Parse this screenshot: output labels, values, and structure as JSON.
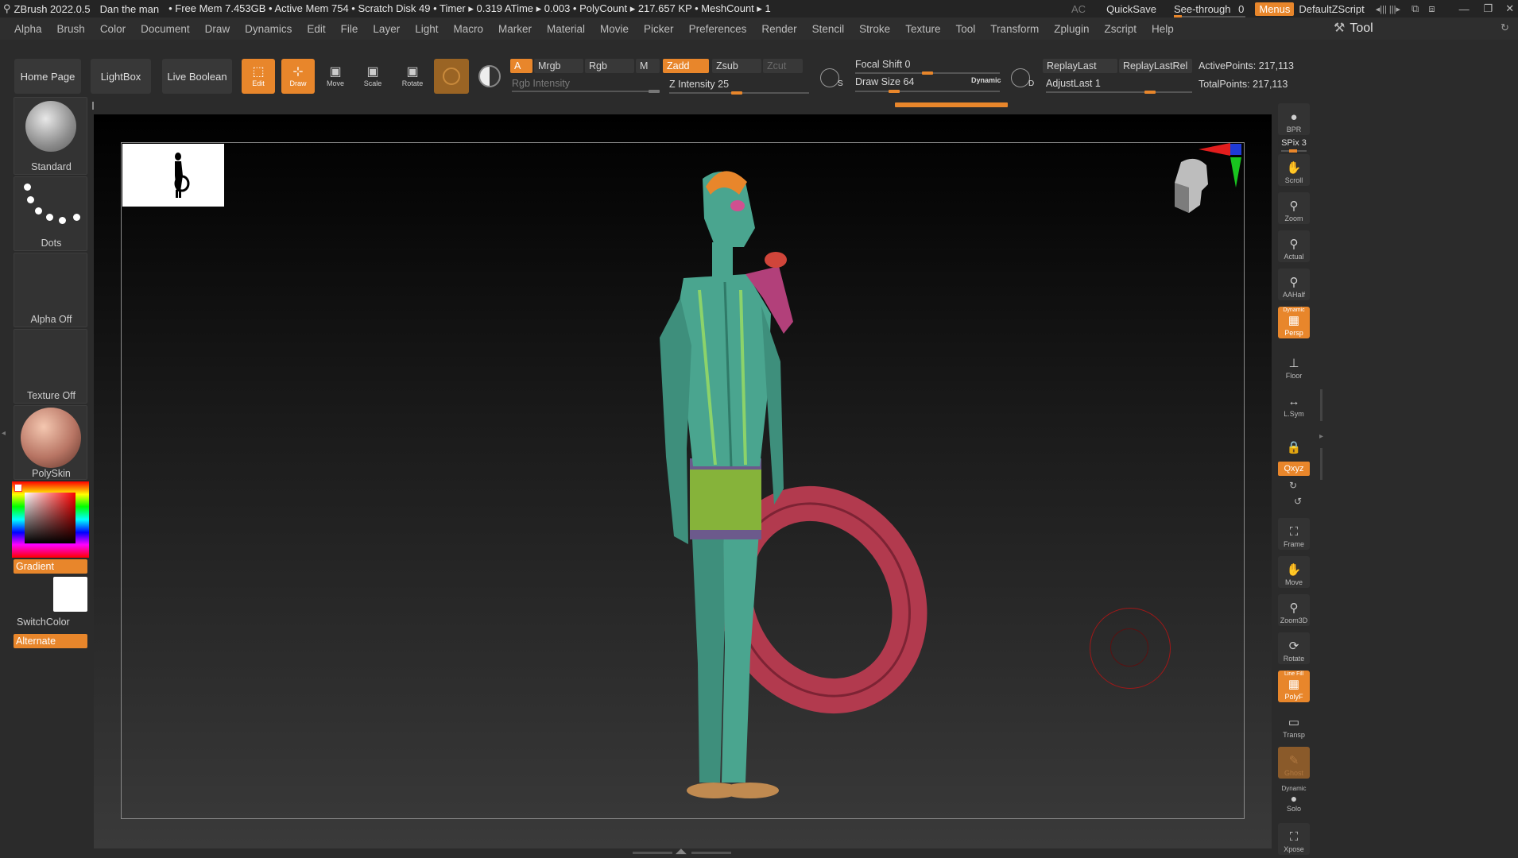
{
  "titlebar": {
    "app_version": "ZBrush 2022.0.5",
    "document_name": "Dan the man",
    "stats": "• Free Mem 7.453GB • Active Mem 754 • Scratch Disk 49 • Timer ▸ 0.319 ATime ▸ 0.003 • PolyCount ▸ 217.657 KP • MeshCount ▸ 1",
    "ac_label": "AC",
    "quicksave_label": "QuickSave",
    "seethrough_label": "See-through",
    "seethrough_value": "0",
    "menus_label": "Menus",
    "zscript_label": "DefaultZScript"
  },
  "menubar": {
    "items": [
      "Alpha",
      "Brush",
      "Color",
      "Document",
      "Draw",
      "Dynamics",
      "Edit",
      "File",
      "Layer",
      "Light",
      "Macro",
      "Marker",
      "Material",
      "Movie",
      "Picker",
      "Preferences",
      "Render",
      "Stencil",
      "Stroke",
      "Texture",
      "Tool",
      "Transform",
      "Zplugin",
      "Zscript",
      "Help"
    ]
  },
  "tool_palette_title": "Tool",
  "toolbar": {
    "home_page": "Home Page",
    "lightbox": "LightBox",
    "live_boolean": "Live Boolean",
    "edit": "Edit",
    "draw": "Draw",
    "move": "Move",
    "scale": "Scale",
    "rotate": "Rotate",
    "a_label": "A",
    "mrgb": "Mrgb",
    "rgb": "Rgb",
    "m": "M",
    "zadd": "Zadd",
    "zsub": "Zsub",
    "zcut": "Zcut",
    "rgb_intensity": "Rgb Intensity",
    "z_intensity_label": "Z Intensity",
    "z_intensity_value": "25",
    "focal_shift_label": "Focal Shift",
    "focal_shift_value": "0",
    "draw_size_label": "Draw Size",
    "draw_size_value": "64",
    "dynamic": "Dynamic",
    "replay_last": "ReplayLast",
    "replay_last_rel": "ReplayLastRel",
    "adjust_last_label": "AdjustLast",
    "adjust_last_value": "1",
    "active_points": "ActivePoints: 217,113",
    "total_points": "TotalPoints: 217,113"
  },
  "leftpanel": {
    "brush": "Standard",
    "stroke": "Dots",
    "alpha": "Alpha Off",
    "texture": "Texture Off",
    "material": "PolySkin",
    "gradient": "Gradient",
    "switch_color": "SwitchColor",
    "alternate": "Alternate"
  },
  "rightshelf": {
    "bpr": "BPR",
    "spix": "SPix 3",
    "scroll": "Scroll",
    "zoom": "Zoom",
    "actual": "Actual",
    "aahalf": "AAHalf",
    "dynamic_label": "Dynamic",
    "persp": "Persp",
    "floor": "Floor",
    "lsym": "L.Sym",
    "xyz": "Qxyz",
    "frame": "Frame",
    "move": "Move",
    "zoom3d": "Zoom3D",
    "rotate": "Rotate",
    "line_fill": "Line Fill",
    "polyf": "PolyF",
    "transp": "Transp",
    "ghost": "Ghost",
    "solo_dynamic": "Dynamic",
    "solo": "Solo",
    "xpose": "Xpose"
  },
  "colors": {
    "accent": "#e8862b",
    "background": "#2b2b2b",
    "skin": "#4aa58f",
    "shorts": "#86b33a",
    "ring": "#b23a4e"
  }
}
